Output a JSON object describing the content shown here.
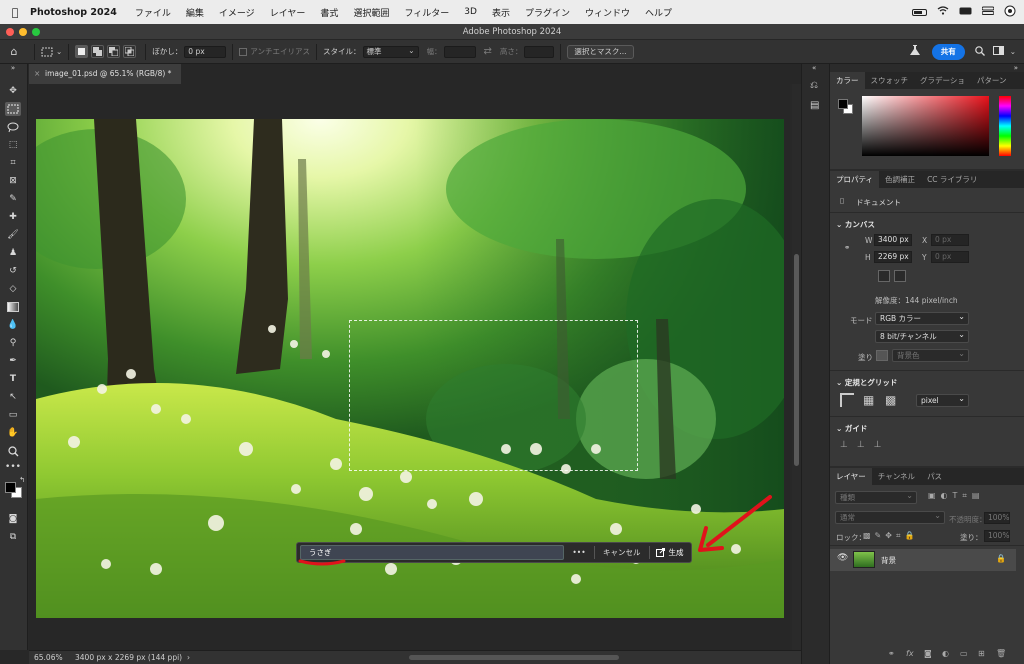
{
  "menubar": {
    "app_name": "Photoshop 2024",
    "items": [
      "ファイル",
      "編集",
      "イメージ",
      "レイヤー",
      "書式",
      "選択範囲",
      "フィルター",
      "3D",
      "表示",
      "プラグイン",
      "ウィンドウ",
      "ヘルプ"
    ]
  },
  "window": {
    "title": "Adobe Photoshop 2024"
  },
  "options": {
    "feather_label": "ぼかし：",
    "feather_value": "0 px",
    "antialias_label": "アンチエイリアス",
    "style_label": "スタイル：",
    "style_value": "標準",
    "width_label": "幅：",
    "height_label": "高さ：",
    "select_mask_label": "選択とマスク...",
    "share_label": "共有"
  },
  "document": {
    "tab_title": "image_01.psd @ 65.1% (RGB/8) *"
  },
  "gen_fill": {
    "prompt_value": "うさぎ",
    "more_label": "•••",
    "cancel_label": "キャンセル",
    "generate_label": "生成"
  },
  "status": {
    "zoom": "65.06%",
    "info": "3400 px x 2269 px (144 ppi)"
  },
  "color_panel": {
    "tabs": [
      "カラー",
      "スウォッチ",
      "グラデーショ",
      "パターン"
    ]
  },
  "properties_panel": {
    "tabs": [
      "プロパティ",
      "色調補正",
      "CC ライブラリ"
    ],
    "doc_label": "ドキュメント",
    "canvas_header": "カンバス",
    "w_label": "W",
    "w_value": "3400 px",
    "h_label": "H",
    "h_value": "2269 px",
    "x_label": "X",
    "x_placeholder": "0 px",
    "y_label": "Y",
    "y_placeholder": "0 px",
    "resolution": "解像度：144 pixel/inch",
    "mode_label": "モード",
    "mode_value": "RGB カラー",
    "depth_value": "8 bit/チャンネル",
    "fill_label": "塗り",
    "fill_value": "背景色",
    "rulers_header": "定規とグリッド",
    "unit_value": "pixel",
    "guides_header": "ガイド"
  },
  "layers_panel": {
    "tabs": [
      "レイヤー",
      "チャンネル",
      "パス"
    ],
    "search_placeholder": "種類",
    "blend_mode": "通常",
    "opacity_label": "不透明度：",
    "opacity_value": "100%",
    "lock_label": "ロック：",
    "fill_label": "塗り：",
    "fill_value": "100%",
    "layer_name": "背景"
  },
  "colors": {
    "accent": "#1473e6",
    "annotation": "#e0121b",
    "panel_bg": "#383838",
    "app_bg": "#282828"
  }
}
